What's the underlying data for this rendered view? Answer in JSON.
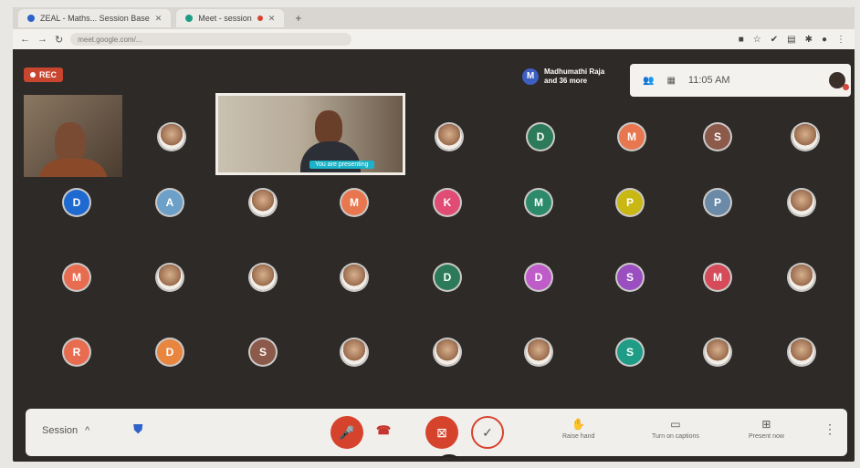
{
  "browser": {
    "tabs": [
      {
        "label": "ZEAL - Maths... Session Base"
      },
      {
        "label": "Meet - session"
      }
    ],
    "new_tab": "+",
    "url": "meet.google.com/..."
  },
  "meeting": {
    "rec_label": "REC",
    "notice_avatar": "M",
    "notice_line1": "Madhumathi Raja",
    "notice_line2": "and 36 more",
    "time": "11:05 AM",
    "presenter_chip": "You are presenting"
  },
  "participants": [
    {
      "initial": "D",
      "color": "#1f6ad1"
    },
    {
      "initial": "A",
      "color": "#6ca0c8"
    },
    {
      "initial": "",
      "color": "photo"
    },
    {
      "initial": "M",
      "color": "#e8774f"
    },
    {
      "initial": "K",
      "color": "#e04c73"
    },
    {
      "initial": "M",
      "color": "#2c8a6a"
    },
    {
      "initial": "P",
      "color": "#c9b813"
    },
    {
      "initial": "P",
      "color": "#6a8aa8"
    },
    {
      "initial": "",
      "color": "photo"
    },
    {
      "initial": "M",
      "color": "#e86c4f"
    },
    {
      "initial": "",
      "color": "photo"
    },
    {
      "initial": "",
      "color": "photo"
    },
    {
      "initial": "",
      "color": "photo"
    },
    {
      "initial": "D",
      "color": "#2c7a5a"
    },
    {
      "initial": "D",
      "color": "#c05cc9"
    },
    {
      "initial": "S",
      "color": "#9a4ec0"
    },
    {
      "initial": "M",
      "color": "#d64b5a"
    },
    {
      "initial": "",
      "color": "photo"
    },
    {
      "initial": "R",
      "color": "#e86c4f"
    },
    {
      "initial": "D",
      "color": "#e8853f"
    },
    {
      "initial": "S",
      "color": "#8c5a4a"
    },
    {
      "initial": "",
      "color": "photo"
    },
    {
      "initial": "",
      "color": "photo"
    },
    {
      "initial": "",
      "color": "photo"
    },
    {
      "initial": "S",
      "color": "#1f9c86"
    },
    {
      "initial": "",
      "color": "photo"
    },
    {
      "initial": "",
      "color": "photo"
    }
  ],
  "top_row_avatars": [
    {
      "initial": "",
      "color": "photo"
    },
    {
      "initial": "",
      "color": "photo"
    },
    {
      "initial": "D",
      "color": "#2c7a5a"
    },
    {
      "initial": "M",
      "color": "#e8774f"
    },
    {
      "initial": "S",
      "color": "#8c5a4a"
    },
    {
      "initial": "",
      "color": "photo"
    }
  ],
  "controls": {
    "session_label": "Session",
    "raise_hand": "Raise hand",
    "turn_on_captions": "Turn on captions",
    "present_now": "Present now",
    "more": "⋮"
  }
}
